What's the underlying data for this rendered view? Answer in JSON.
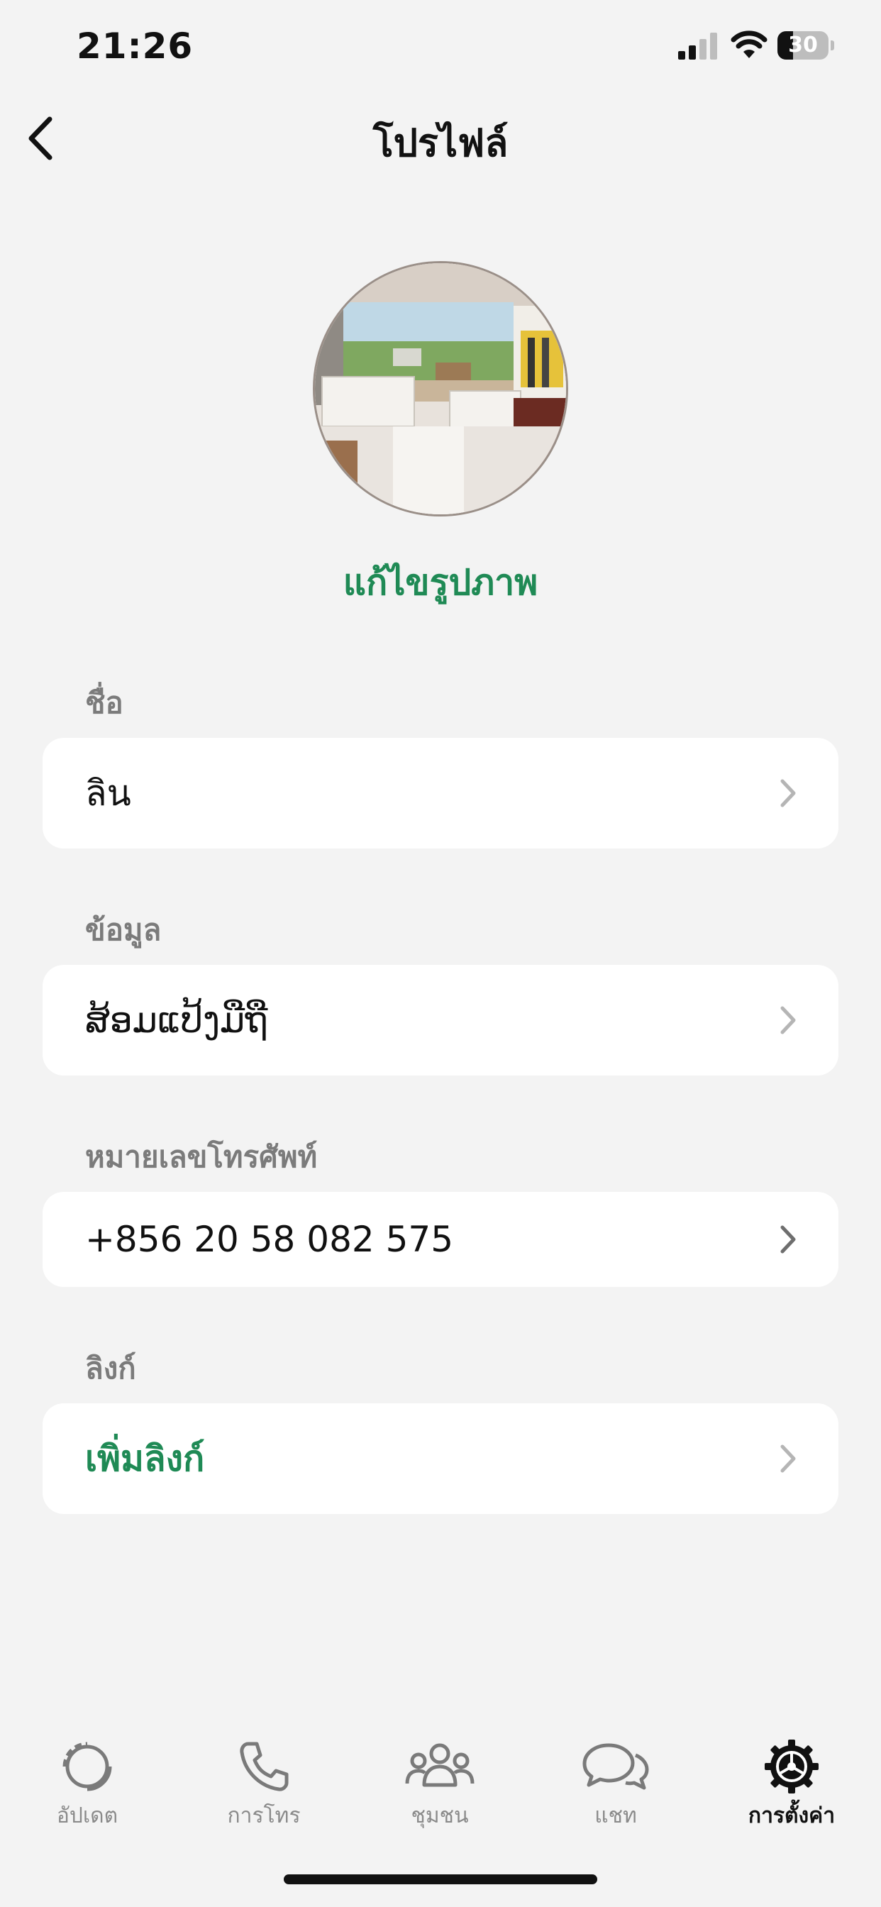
{
  "status_bar": {
    "time": "21:26",
    "battery_level": "30",
    "battery_fraction": 0.3
  },
  "header": {
    "title": "โปรไฟล์",
    "back_icon": "chevron-left-icon"
  },
  "profile": {
    "edit_photo_label": "แก้ไขรูปภาพ"
  },
  "fields": {
    "name": {
      "label": "ชื่อ",
      "value": "ลิน"
    },
    "about": {
      "label": "ข้อมูล",
      "value": "ສ້ອມແປ້ງມືຖື"
    },
    "phone": {
      "label": "หมายเลขโทรศัพท์",
      "value": "+856 20 58 082 575"
    },
    "link": {
      "label": "ลิงก์",
      "value": "เพิ่มลิงก์"
    }
  },
  "bottom_nav": {
    "items": [
      {
        "label": "อัปเดต",
        "icon": "updates-icon"
      },
      {
        "label": "การโทร",
        "icon": "phone-icon"
      },
      {
        "label": "ชุมชน",
        "icon": "communities-icon"
      },
      {
        "label": "แชท",
        "icon": "chats-icon"
      },
      {
        "label": "การตั้งค่า",
        "icon": "settings-icon"
      }
    ],
    "active_index": 4
  },
  "colors": {
    "accent_green": "#1f8a55",
    "background": "#f3f3f3",
    "card": "#ffffff",
    "muted_text": "#7b7b7b"
  }
}
